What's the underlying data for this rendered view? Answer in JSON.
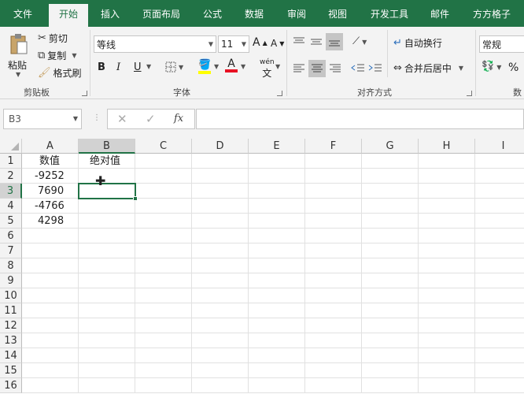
{
  "tabs": [
    "文件",
    "开始",
    "插入",
    "页面布局",
    "公式",
    "数据",
    "审阅",
    "视图",
    "开发工具",
    "邮件",
    "方方格子"
  ],
  "active_tab": "开始",
  "clipboard": {
    "paste": "粘贴",
    "cut": "剪切",
    "copy": "复制",
    "format_painter": "格式刷",
    "group": "剪贴板"
  },
  "font": {
    "name": "等线",
    "size": "11",
    "bold": "B",
    "italic": "I",
    "underline": "U",
    "grow": "A",
    "shrink": "A",
    "phonetic": "wén",
    "group": "字体"
  },
  "alignment": {
    "wrap_text": "自动换行",
    "merge_center": "合并后居中",
    "group": "对齐方式"
  },
  "number": {
    "format": "常规",
    "percent": "%",
    "group": "数"
  },
  "name_box": "B3",
  "formula_icons": {
    "cancel": "✕",
    "enter": "✓",
    "fx": "fx"
  },
  "columns": [
    "A",
    "B",
    "C",
    "D",
    "E",
    "F",
    "G",
    "H",
    "I"
  ],
  "rows": [
    "1",
    "2",
    "3",
    "4",
    "5",
    "6",
    "7",
    "8",
    "9",
    "10",
    "11",
    "12",
    "13",
    "14",
    "15",
    "16"
  ],
  "cells": {
    "A1": "数值",
    "B1": "绝对值",
    "A2": "-9252",
    "A3": "7690",
    "A4": "-4766",
    "A5": "4298"
  },
  "colors": {
    "accent": "#217346",
    "font_color": "#e81123",
    "highlight": "#ffff00"
  }
}
